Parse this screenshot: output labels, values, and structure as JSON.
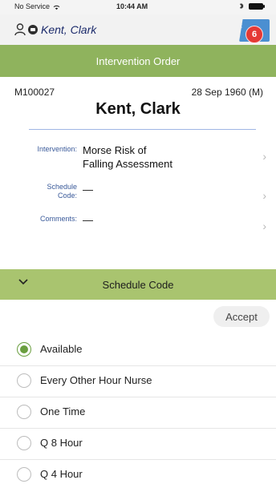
{
  "status_bar": {
    "carrier": "No Service",
    "time": "10:44 AM"
  },
  "patient_header": {
    "name": "Kent, Clark",
    "notification_count": "6",
    "notification_color": "#e53935",
    "tab_color": "#4b8fd1"
  },
  "title_bar": {
    "title": "Intervention Order",
    "color": "#8fb35d"
  },
  "patient": {
    "mrn": "M100027",
    "dob": "28 Sep 1960 (M)",
    "name": "Kent, Clark"
  },
  "details": [
    {
      "label": "Intervention:",
      "value_line1": "Morse Risk of",
      "value_line2": "Falling Assessment"
    },
    {
      "label": "Schedule Code:",
      "value_line1": "—",
      "value_line2": ""
    },
    {
      "label": "Comments:",
      "value_line1": "—",
      "value_line2": ""
    }
  ],
  "schedule": {
    "title": "Schedule Code",
    "accept_label": "Accept",
    "options": [
      {
        "label": "Available",
        "selected": true
      },
      {
        "label": "Every Other Hour Nurse",
        "selected": false
      },
      {
        "label": "One Time",
        "selected": false
      },
      {
        "label": "Q 8 Hour",
        "selected": false
      },
      {
        "label": "Q 4 Hour",
        "selected": false
      }
    ]
  }
}
